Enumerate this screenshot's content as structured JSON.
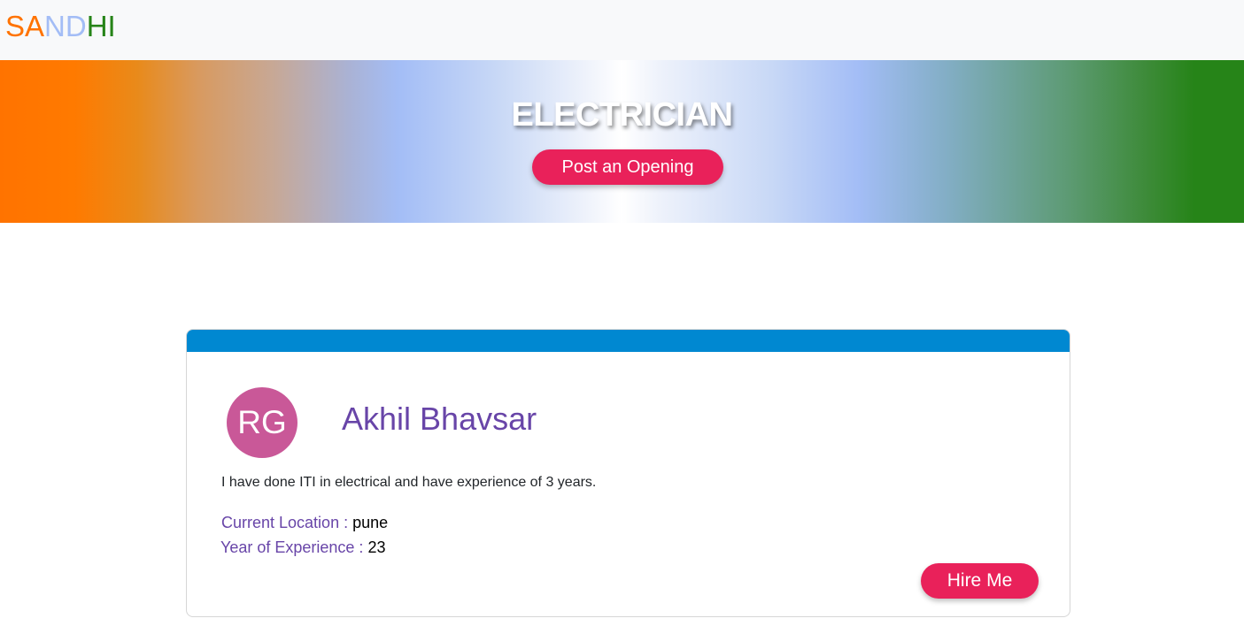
{
  "navbar": {
    "brand_letters": [
      {
        "text": "SA",
        "color": "#ff7300"
      },
      {
        "text": "ND",
        "color": "#a3bdf6"
      },
      {
        "text": "HI",
        "color": "#268418"
      }
    ]
  },
  "hero": {
    "title": "ELECTRICIAN",
    "post_button_label": "Post an Opening",
    "gradient_colors": [
      "#ff7300",
      "#a3bdf6",
      "#ffffff",
      "#a3bdf6",
      "#268418"
    ]
  },
  "profile_card": {
    "header_color": "#0088d1",
    "avatar_initials": "RG",
    "avatar_color": "#c95898",
    "name": "Akhil Bhavsar",
    "description": "I have done ITI in electrical and have experience of 3 years.",
    "location_label": "Current Location :",
    "location_value": "pune",
    "experience_label": "Year of Experience :",
    "experience_value": "23",
    "hire_button_label": "Hire Me",
    "accent_color": "#6845a8",
    "button_color": "#e9215a"
  }
}
